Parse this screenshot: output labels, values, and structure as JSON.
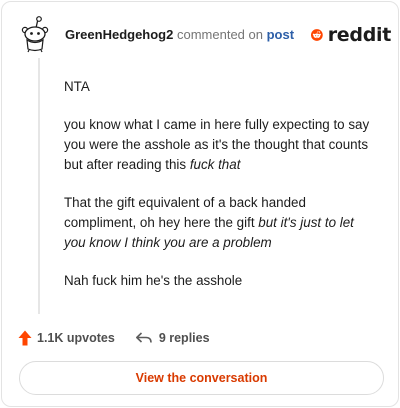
{
  "header": {
    "username": "GreenHedgehog2",
    "action_text": "commented on",
    "post_link": "post"
  },
  "logo": {
    "text": "reddit",
    "icon": "reddit-snoo-icon",
    "color": "#ff4500"
  },
  "comment": {
    "p1": "NTA",
    "p2_plain": "you know what I came in here fully expecting to say you were the asshole as it's the thought that counts but after reading this ",
    "p2_italic": "fuck that",
    "p3_plain": "That the gift equivalent of a back handed compliment, oh hey here the gift ",
    "p3_italic": "but it's just to let you know I think you are a problem",
    "p4": "Nah fuck him he's the asshole"
  },
  "actions": {
    "upvotes": "1.1K upvotes",
    "upvote_icon": "upvote-arrow-icon",
    "upvote_color": "#ff4500",
    "replies": "9 replies",
    "reply_icon": "reply-arrow-icon"
  },
  "view_button": {
    "label": "View the conversation",
    "color": "#d93a00"
  }
}
